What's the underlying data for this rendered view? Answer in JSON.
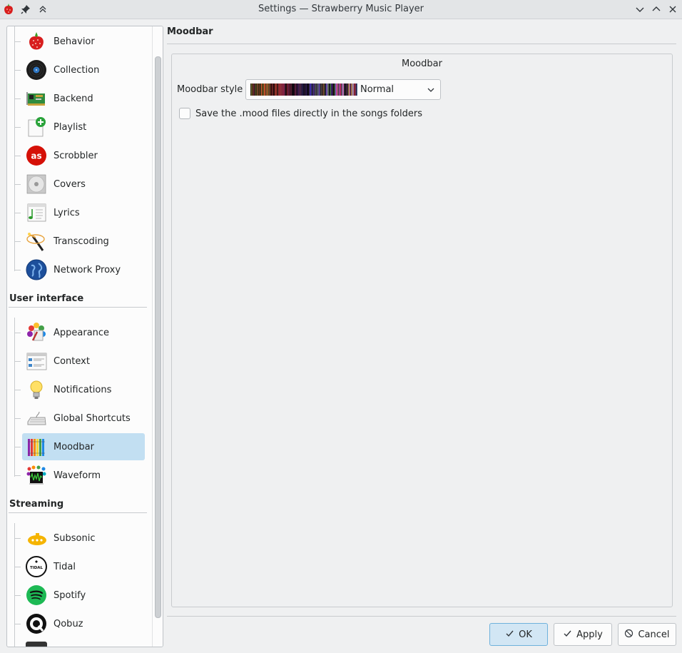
{
  "window": {
    "title": "Settings — Strawberry Music Player"
  },
  "sidebar": {
    "group_general": [
      {
        "label": "Behavior",
        "icon": "strawberry-icon"
      },
      {
        "label": "Collection",
        "icon": "vinyl-record-icon"
      },
      {
        "label": "Backend",
        "icon": "circuit-board-icon"
      },
      {
        "label": "Playlist",
        "icon": "playlist-add-icon"
      },
      {
        "label": "Scrobbler",
        "icon": "lastfm-icon"
      },
      {
        "label": "Covers",
        "icon": "cd-cover-icon"
      },
      {
        "label": "Lyrics",
        "icon": "lyrics-icon"
      },
      {
        "label": "Transcoding",
        "icon": "magic-wand-icon"
      },
      {
        "label": "Network Proxy",
        "icon": "globe-icon"
      }
    ],
    "section_ui": "User interface",
    "group_ui": [
      {
        "label": "Appearance",
        "icon": "color-palette-icon"
      },
      {
        "label": "Context",
        "icon": "context-window-icon"
      },
      {
        "label": "Notifications",
        "icon": "lightbulb-icon"
      },
      {
        "label": "Global Shortcuts",
        "icon": "keyboard-icon"
      },
      {
        "label": "Moodbar",
        "icon": "crayons-icon"
      },
      {
        "label": "Waveform",
        "icon": "waveform-icon"
      }
    ],
    "section_streaming": "Streaming",
    "group_streaming": [
      {
        "label": "Subsonic",
        "icon": "subsonic-icon"
      },
      {
        "label": "Tidal",
        "icon": "tidal-icon"
      },
      {
        "label": "Spotify",
        "icon": "spotify-icon"
      },
      {
        "label": "Qobuz",
        "icon": "qobuz-icon"
      }
    ],
    "selected": "Moodbar"
  },
  "main": {
    "page_title": "Moodbar",
    "group_title": "Moodbar",
    "style_label": "Moodbar style",
    "style_value": "Normal",
    "save_checkbox_label": "Save the .mood files directly in the songs folders",
    "save_checked": false
  },
  "buttons": {
    "ok": "OK",
    "apply": "Apply",
    "cancel": "Cancel"
  },
  "colors": {
    "selection": "#c2dff2",
    "accent": "#3daee9",
    "spotify": "#1db954",
    "lastfm": "#d51007"
  }
}
